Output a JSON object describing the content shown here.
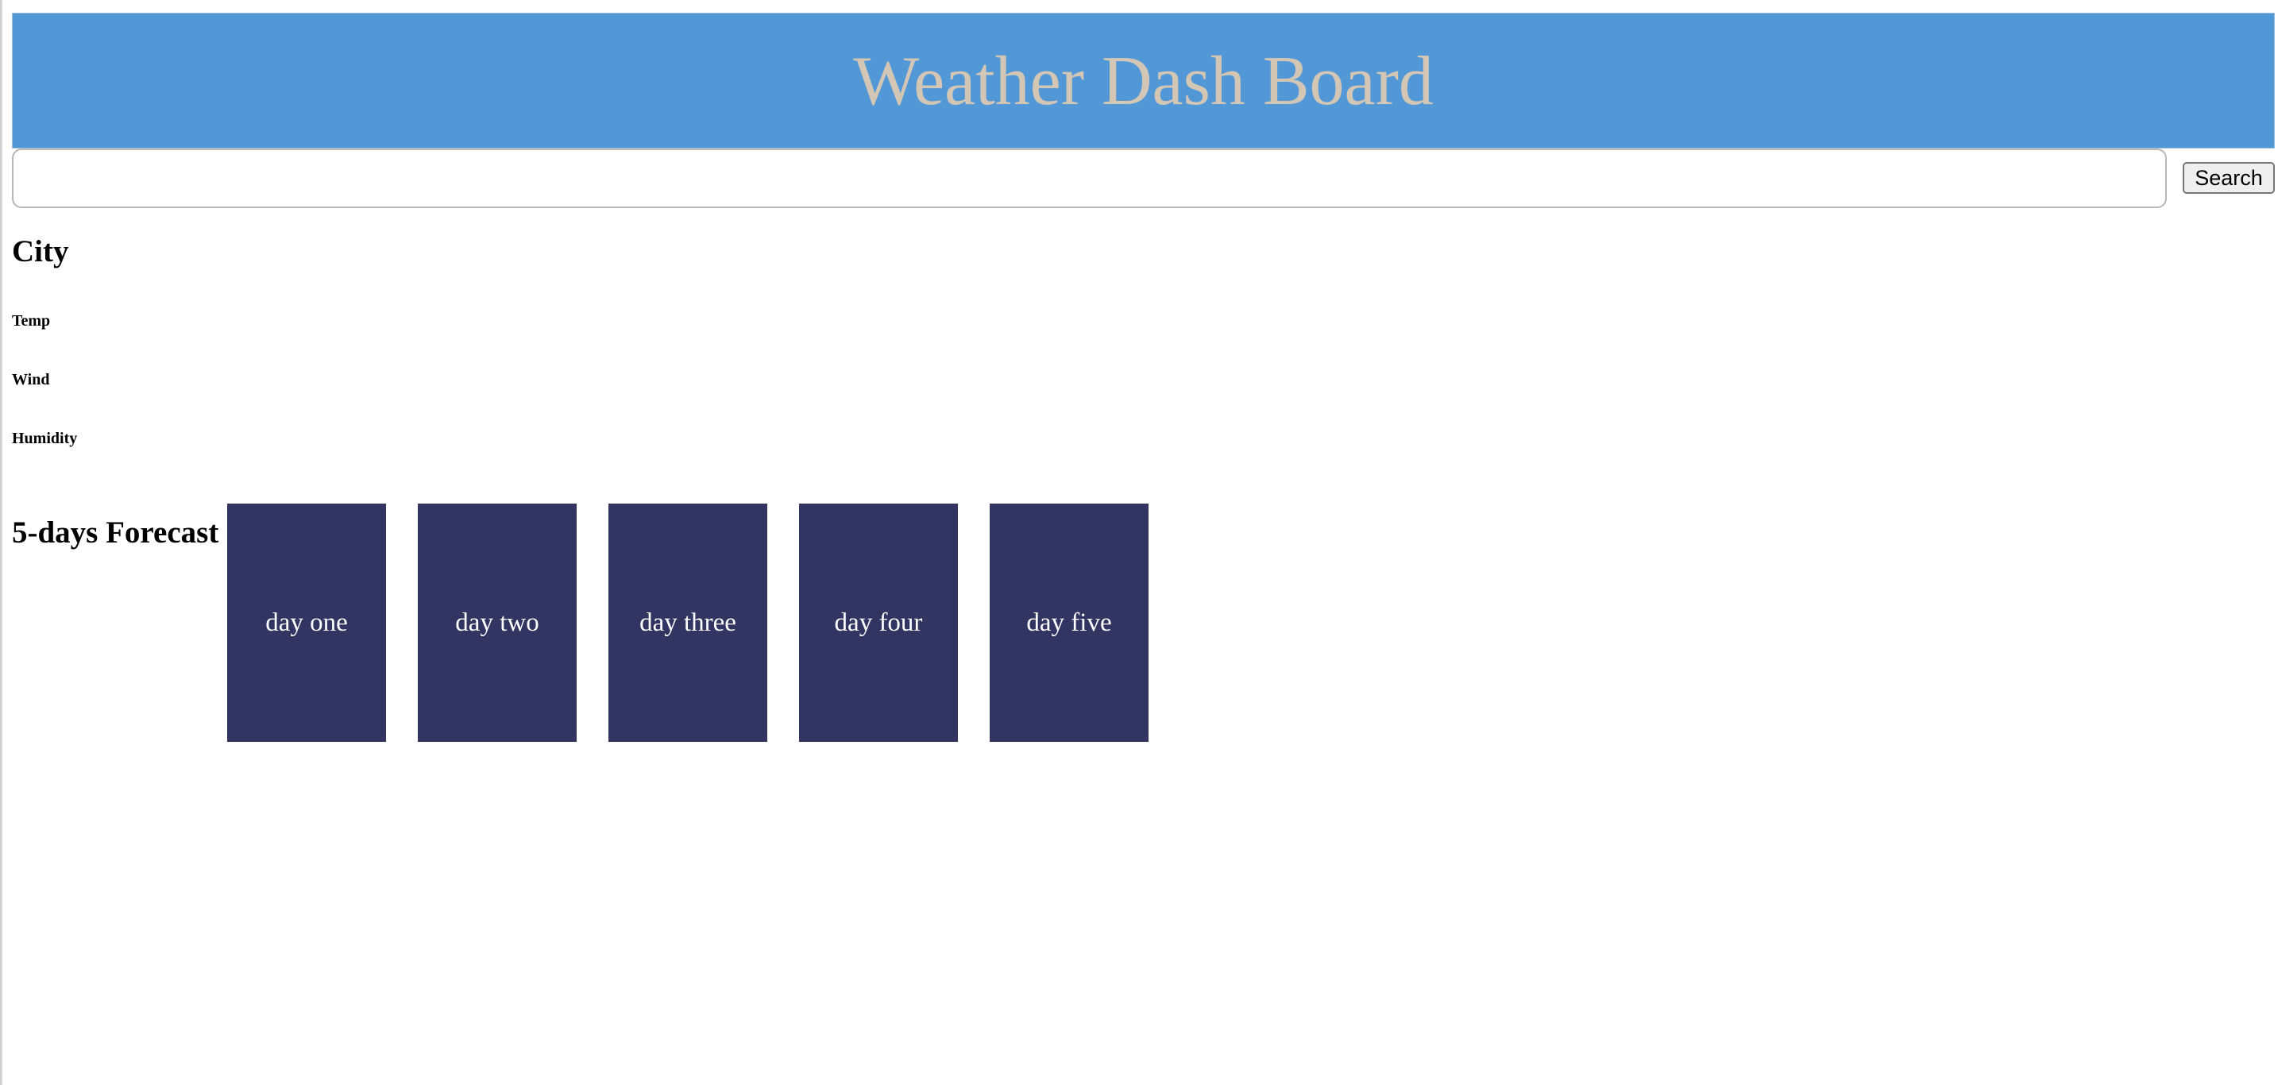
{
  "header": {
    "title": "Weather Dash Board",
    "background_color": "#5298d6",
    "title_color": "#d4c6b4"
  },
  "search": {
    "value": "",
    "placeholder": "",
    "button_label": "Search"
  },
  "current": {
    "city_label": "City",
    "temp_label": "Temp",
    "wind_label": "Wind",
    "humidity_label": "Humidity"
  },
  "forecast": {
    "title": "5-days Forecast",
    "card_color": "#323462",
    "days": [
      {
        "label": "day one"
      },
      {
        "label": "day two"
      },
      {
        "label": "day three"
      },
      {
        "label": "day four"
      },
      {
        "label": "day five"
      }
    ]
  }
}
